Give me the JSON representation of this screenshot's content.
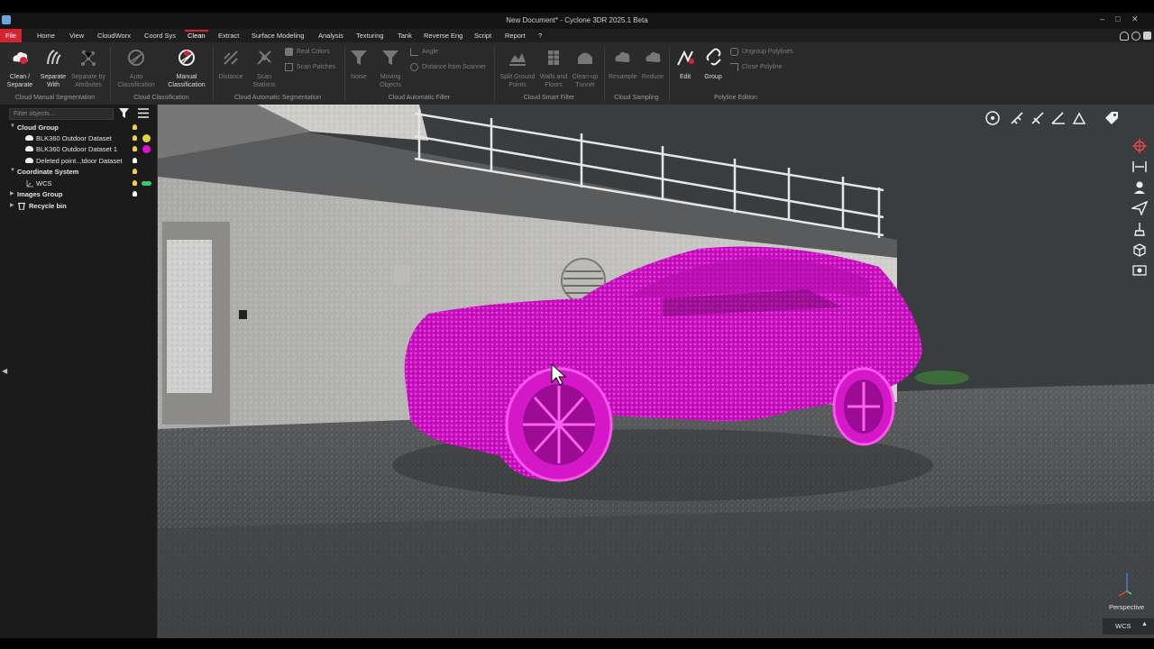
{
  "window": {
    "title": "New Document* - Cyclone 3DR 2025.1 Beta",
    "controls": [
      "–",
      "□",
      "✕"
    ]
  },
  "menu": {
    "items": [
      {
        "label": "File"
      },
      {
        "label": "Home"
      },
      {
        "label": "View"
      },
      {
        "label": "CloudWorx"
      },
      {
        "label": "Coord Sys"
      },
      {
        "label": "Clean"
      },
      {
        "label": "Extract"
      },
      {
        "label": "Surface Modeling"
      },
      {
        "label": "Analysis"
      },
      {
        "label": "Texturing"
      },
      {
        "label": "Tank"
      },
      {
        "label": "Reverse Eng"
      },
      {
        "label": "Script"
      },
      {
        "label": "Report"
      },
      {
        "label": "?"
      }
    ],
    "active": "Clean"
  },
  "ribbon": {
    "buttons": {
      "clean_separate": "Clean / Separate",
      "separate_with": "Separate With",
      "separate_by_attributes": "Separate by Attributes",
      "auto_classification": "Auto Classification",
      "manual_classification": "Manual Classification",
      "distance": "Distance",
      "scan_stations": "Scan Stations",
      "real_colors": "Real Colors",
      "scan_patches": "Scan Patches",
      "noise": "Noise",
      "moving_objects": "Moving Objects",
      "angle": "Angle",
      "distance_from_scanner": "Distance from Scanner",
      "split_ground_points": "Split Ground Points",
      "walls_and_floors": "Walls and Floors",
      "clean_up_tunnel": "Clean-up Tunnel",
      "resample": "Resample",
      "reduce": "Reduce",
      "edit": "Edit",
      "group": "Group",
      "ungroup_polylines": "Ungroup Polylines",
      "close_polyline": "Close Polyline"
    },
    "groups": {
      "cloud_manual_segmentation": "Cloud Manual Segmentation",
      "cloud_classification": "Cloud Classification",
      "cloud_automatic_segmentation": "Cloud Automatic Segmentation",
      "cloud_automatic_filter": "Cloud Automatic Filter",
      "cloud_smart_filter": "Cloud Smart Filter",
      "cloud_sampling": "Cloud Sampling",
      "polyline_edition": "Polyline Edition"
    }
  },
  "tree": {
    "filter_placeholder": "Filter objects...",
    "items": [
      {
        "label": "Cloud Group",
        "color": ""
      },
      {
        "label": "BLK360 Outdoor Dataset",
        "color": "#d8d838"
      },
      {
        "label": "BLK360 Outdoor Dataset 1",
        "color": "#e010d0"
      },
      {
        "label": "Deleted point...tdoor Dataset",
        "color": ""
      },
      {
        "label": "Coordinate System",
        "color": ""
      },
      {
        "label": "WCS",
        "color": "#38c870"
      },
      {
        "label": "Images Group",
        "color": ""
      },
      {
        "label": "Recycle bin",
        "color": ""
      }
    ]
  },
  "viewport": {
    "projection": "Perspective",
    "coord_system": "WCS",
    "highlight_color": "#e21ad6"
  }
}
